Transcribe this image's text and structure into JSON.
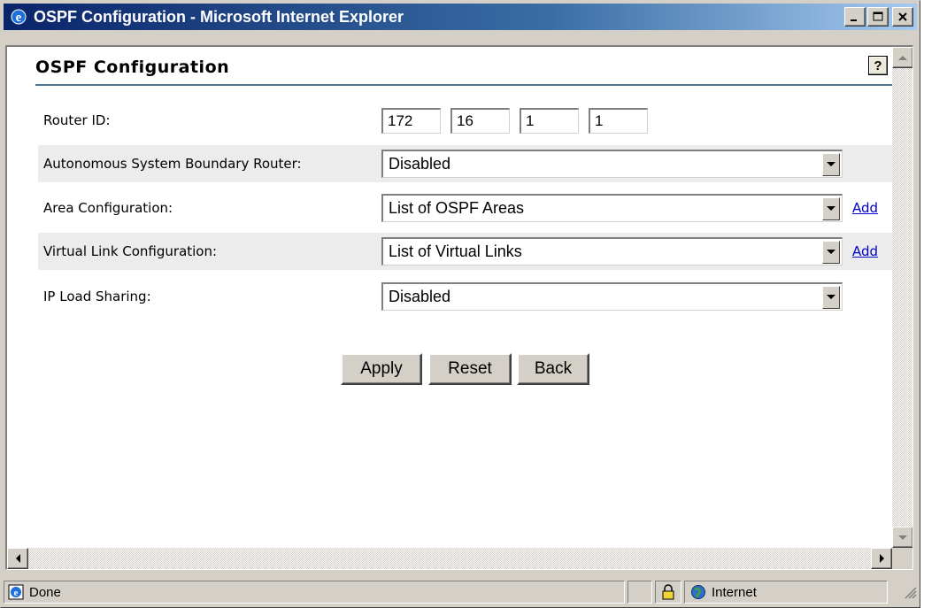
{
  "window": {
    "title": "OSPF Configuration - Microsoft Internet Explorer",
    "minimize_glyph": "_",
    "maximize_glyph": "□",
    "close_glyph": "×"
  },
  "page": {
    "title": "OSPF Configuration",
    "help_glyph": "?"
  },
  "form": {
    "router_id": {
      "label": "Router ID:",
      "octets": [
        "172",
        "16",
        "1",
        "1"
      ]
    },
    "asbr": {
      "label": "Autonomous System Boundary Router:",
      "selected": "Disabled"
    },
    "area": {
      "label": "Area Configuration:",
      "selected": "List of OSPF Areas",
      "add_label": "Add"
    },
    "virtual_link": {
      "label": "Virtual Link Configuration:",
      "selected": "List of Virtual Links",
      "add_label": "Add"
    },
    "load_sharing": {
      "label": "IP Load Sharing:",
      "selected": "Disabled"
    }
  },
  "buttons": {
    "apply": "Apply",
    "reset": "Reset",
    "back": "Back"
  },
  "statusbar": {
    "status": "Done",
    "zone": "Internet"
  },
  "colors": {
    "title_rule": "#4e7a93",
    "link": "#0000cc",
    "row_shade": "#ececec",
    "chrome": "#d4d0c8"
  }
}
